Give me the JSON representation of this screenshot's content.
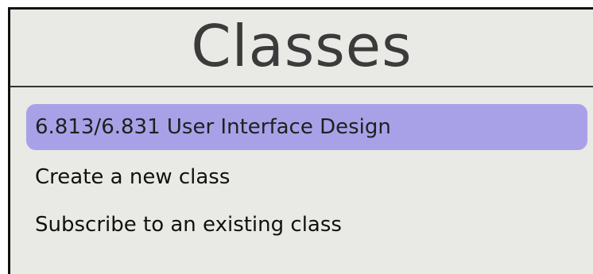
{
  "header": {
    "title": "Classes"
  },
  "classes": {
    "items": [
      {
        "label": "6.813/6.831 User Interface Design",
        "selected": true
      }
    ],
    "actions": [
      {
        "label": "Create a new class"
      },
      {
        "label": "Subscribe to an existing class"
      }
    ]
  },
  "colors": {
    "panel_background": "#e9e9e5",
    "selection_highlight": "#a9a1e8",
    "border": "#111111"
  }
}
